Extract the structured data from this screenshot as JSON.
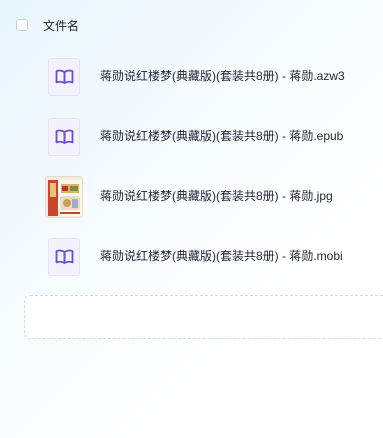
{
  "header": {
    "column_label": "文件名"
  },
  "files": [
    {
      "name": "蒋勋说红楼梦(典藏版)(套装共8册) - 蒋勋.azw3",
      "icon": "book-icon"
    },
    {
      "name": "蒋勋说红楼梦(典藏版)(套装共8册) - 蒋勋.epub",
      "icon": "book-icon"
    },
    {
      "name": "蒋勋说红楼梦(典藏版)(套装共8册) - 蒋勋.jpg",
      "icon": "image-thumbnail"
    },
    {
      "name": "蒋勋说红楼梦(典藏版)(套装共8册) - 蒋勋.mobi",
      "icon": "book-icon"
    }
  ],
  "colors": {
    "book_icon": "#6a4fc8",
    "text": "#1f2533"
  }
}
